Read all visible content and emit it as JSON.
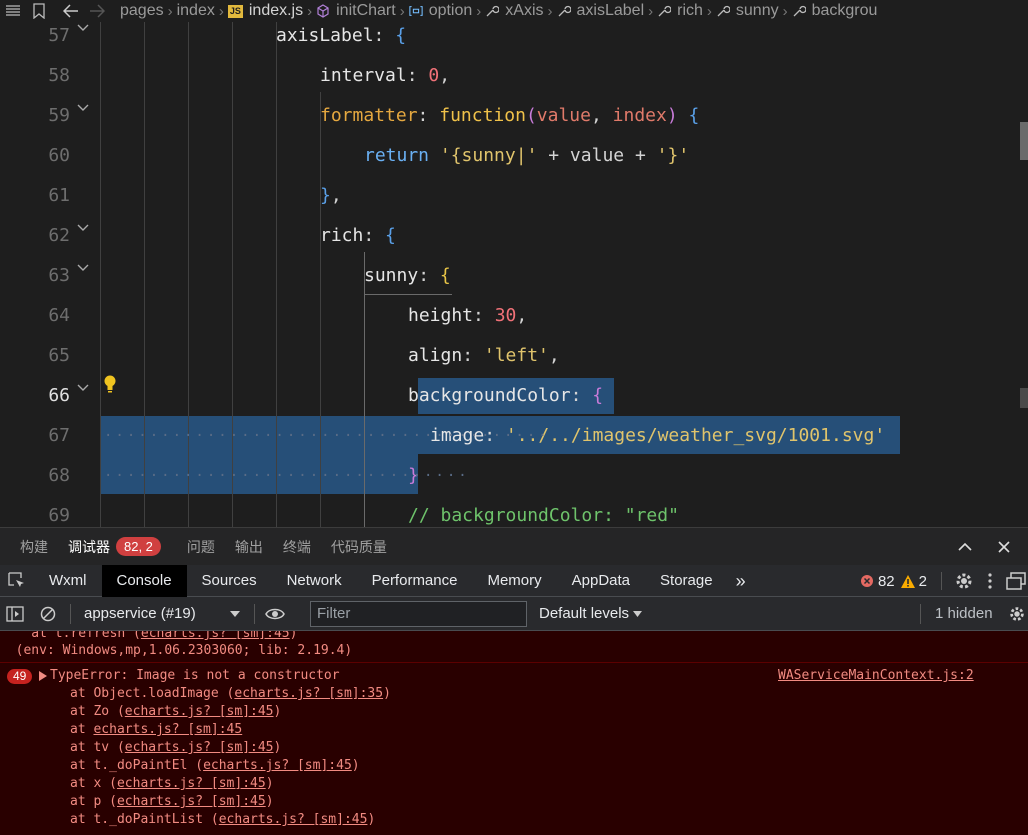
{
  "breadcrumb": {
    "items": [
      "pages",
      "index",
      "index.js",
      "initChart",
      "option",
      "xAxis",
      "axisLabel",
      "rich",
      "sunny",
      "backgrou"
    ]
  },
  "editor": {
    "line_numbers": [
      "57",
      "58",
      "59",
      "60",
      "61",
      "62",
      "63",
      "64",
      "65",
      "66",
      "67",
      "68",
      "69"
    ],
    "current_line": "66",
    "lines": {
      "l57": {
        "prop": "axisLabel",
        "rest": ": {"
      },
      "l58": {
        "prop": "interval",
        "colon": ": ",
        "num": "0",
        "end": ","
      },
      "l59": {
        "kw": "formatter",
        "colon": ": ",
        "fn": "function",
        "p1": "value",
        "p2": "index",
        "end": ") {"
      },
      "l60": {
        "ret": "return",
        "s1": "'{sunny|'",
        "plus1": " + value + ",
        "s2": "'}'"
      },
      "l61": {
        "text": "},"
      },
      "l62": {
        "prop": "rich",
        "rest": ": {"
      },
      "l63": {
        "prop": "sunny",
        "colon": ": ",
        "brace": "{"
      },
      "l64": {
        "prop": "height",
        "colon": ": ",
        "num": "30",
        "end": ","
      },
      "l65": {
        "prop": "align",
        "colon": ": ",
        "str": "'left'",
        "end": ","
      },
      "l66": {
        "prop": "backgroundColor",
        "colon": ": ",
        "brace": "{"
      },
      "l67": {
        "prop": "image",
        "colon": ": ",
        "str": "'../../images/weather_svg/1001.svg'"
      },
      "l68": {
        "brace": "}"
      },
      "l69": {
        "comment": "// backgroundColor: \"red\""
      }
    }
  },
  "panel": {
    "tabs": [
      "构建",
      "调试器",
      "问题",
      "输出",
      "终端",
      "代码质量"
    ],
    "active_tab": "调试器",
    "error_badge": "82, 2"
  },
  "devtools": {
    "tabs": [
      "Wxml",
      "Console",
      "Sources",
      "Network",
      "Performance",
      "Memory",
      "AppData",
      "Storage"
    ],
    "active_tab": "Console",
    "more": "»",
    "error_count": "82",
    "warning_count": "2"
  },
  "console_toolbar": {
    "context": "appservice (#19)",
    "filter_placeholder": "Filter",
    "levels": "Default levels",
    "hidden": "1 hidden"
  },
  "console": {
    "prev_top_prefix": "    at t.refresh (",
    "prev_top_link": "echarts.js? [sm]:45",
    "prev_top_suffix": ")",
    "env_line": "  (env: Windows,mp,1.06.2303060; lib: 2.19.4)",
    "error_repeat": "49",
    "error_message": "TypeError: Image is not a constructor",
    "source_link": "WAServiceMainContext.js:2",
    "stack": [
      {
        "prefix": "at Object.loadImage (",
        "link": "echarts.js? [sm]:35",
        "suffix": ")"
      },
      {
        "prefix": "at Zo (",
        "link": "echarts.js? [sm]:45",
        "suffix": ")"
      },
      {
        "prefix": "at ",
        "link": "echarts.js? [sm]:45",
        "suffix": ""
      },
      {
        "prefix": "at tv (",
        "link": "echarts.js? [sm]:45",
        "suffix": ")"
      },
      {
        "prefix": "at t._doPaintEl (",
        "link": "echarts.js? [sm]:45",
        "suffix": ")"
      },
      {
        "prefix": "at x (",
        "link": "echarts.js? [sm]:45",
        "suffix": ")"
      },
      {
        "prefix": "at p (",
        "link": "echarts.js? [sm]:45",
        "suffix": ")"
      },
      {
        "prefix": "at t._doPaintList (",
        "link": "echarts.js? [sm]:45",
        "suffix": ")"
      }
    ]
  },
  "colors": {
    "editor_bg": "#1e1e1e",
    "selection": "#264f78",
    "console_error_bg": "#290000",
    "error_text": "#f28b82",
    "badge_red": "#d04040"
  }
}
